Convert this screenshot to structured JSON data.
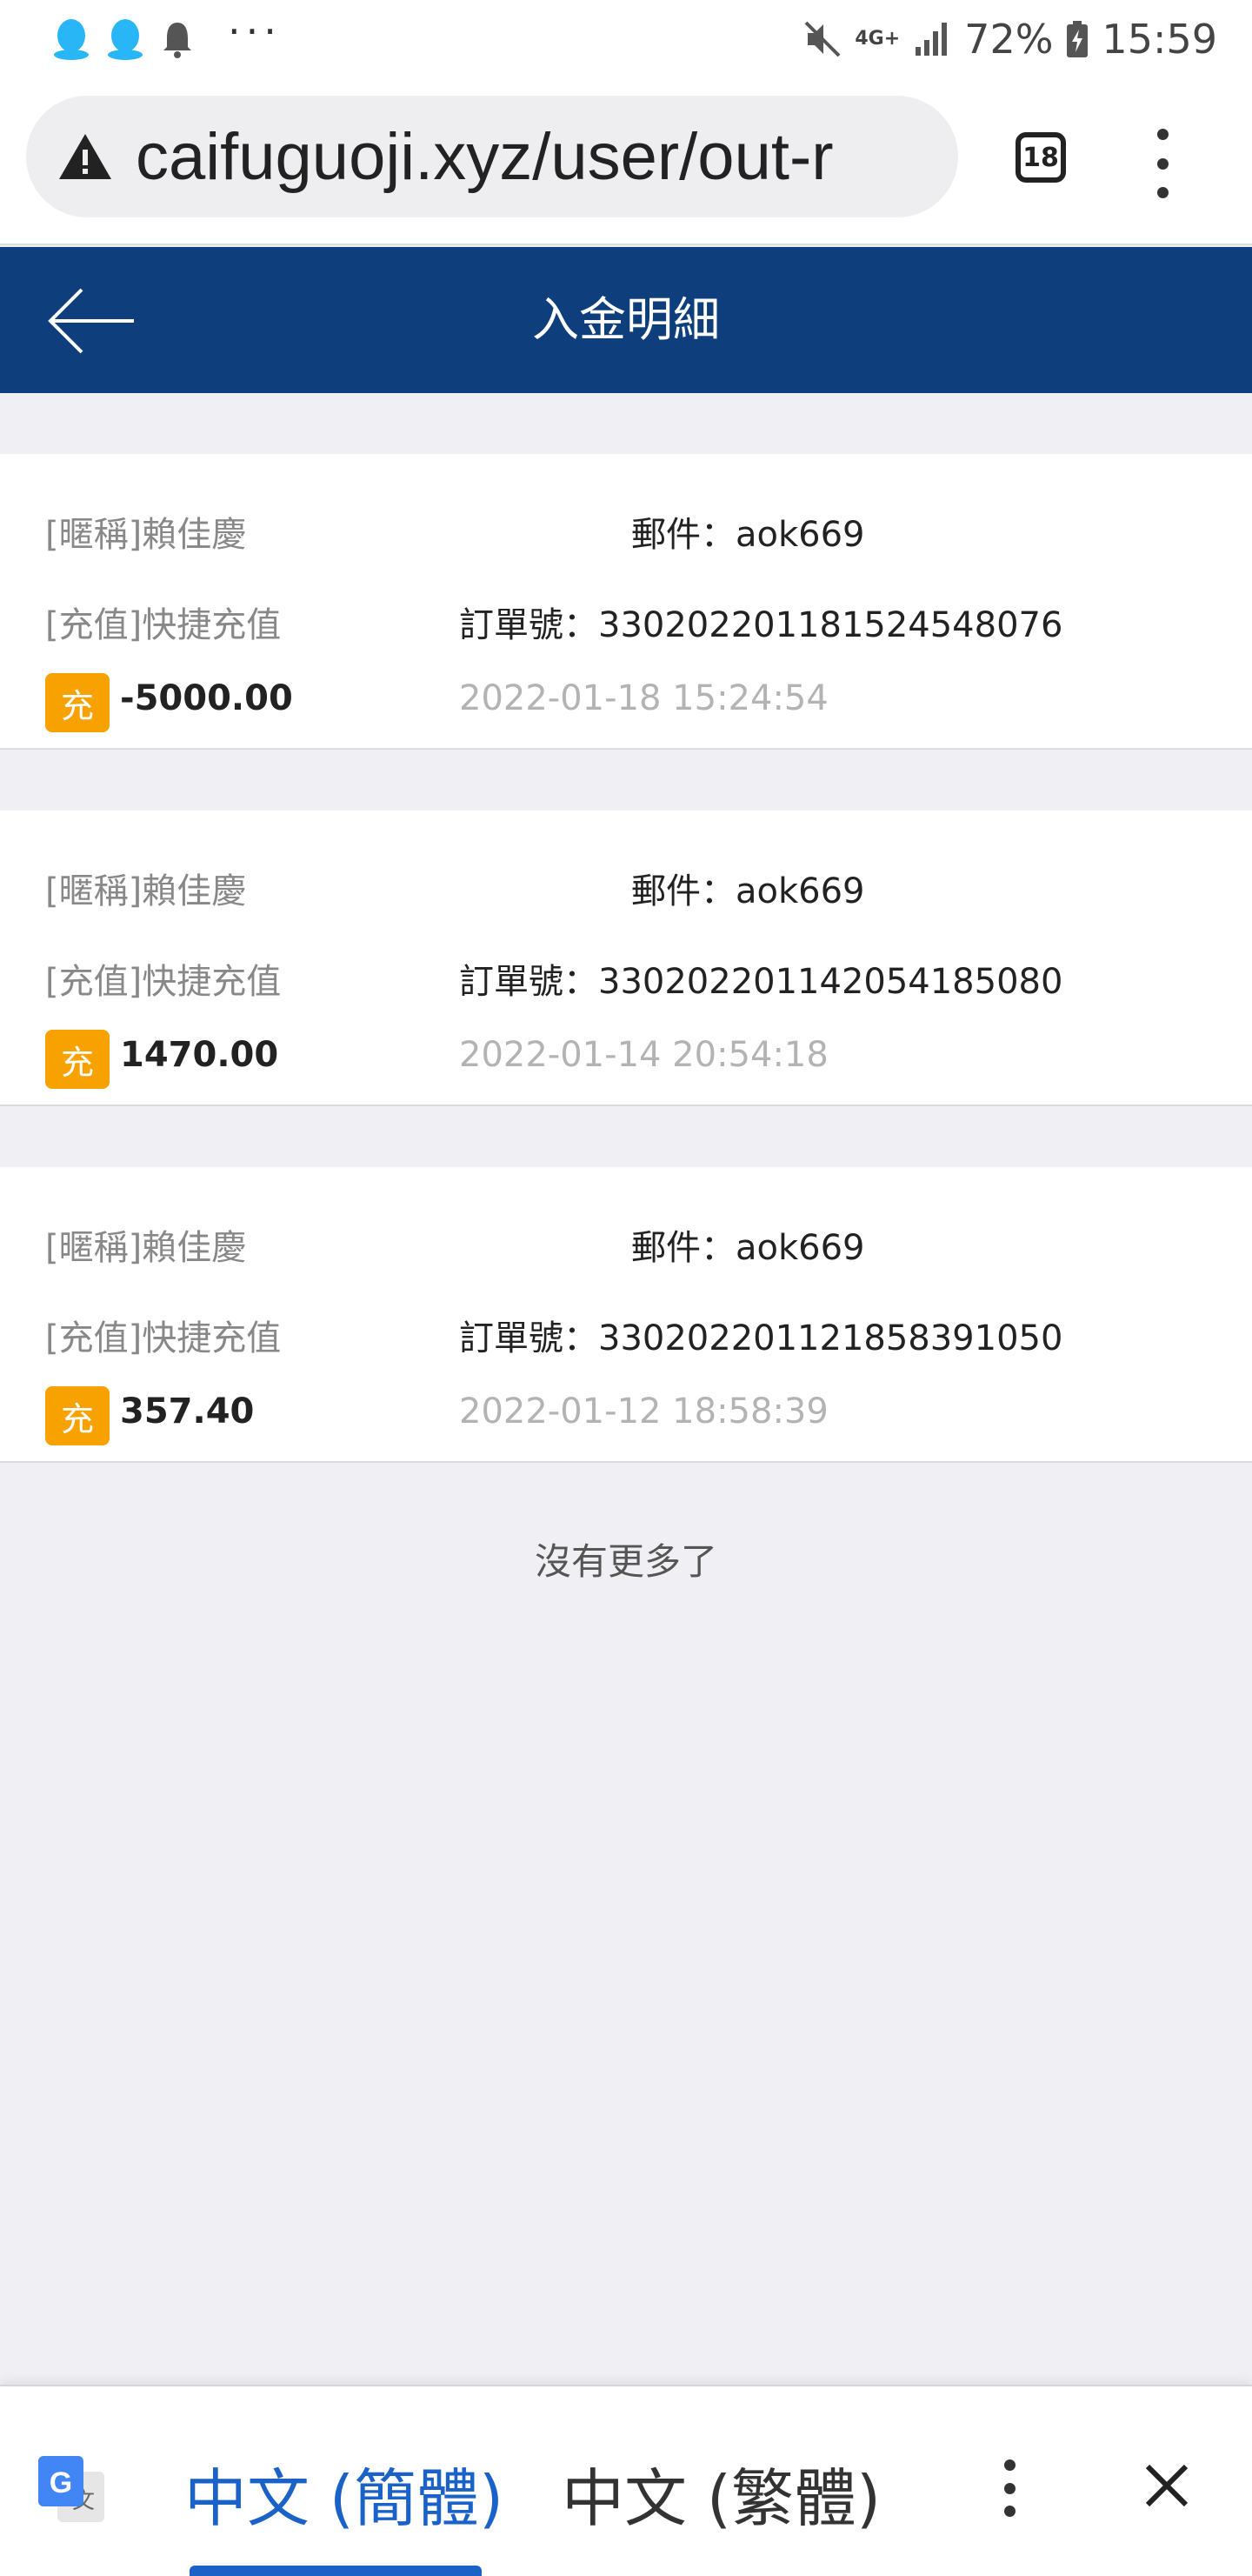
{
  "status_bar": {
    "battery": "72%",
    "time": "15:59",
    "network": "4G+"
  },
  "browser": {
    "url": "caifuguoji.xyz/user/out-r",
    "tab_count": "18"
  },
  "header": {
    "title": "入金明細"
  },
  "records": [
    {
      "nickname": "[暱稱]賴佳慶",
      "email": "郵件：aok669",
      "type": "[充值]快捷充值",
      "order": "訂單號：33020220118152454807​6",
      "badge": "充",
      "amount": "-5000.00",
      "datetime": "2022-01-18 15:24:54"
    },
    {
      "nickname": "[暱稱]賴佳慶",
      "email": "郵件：aok669",
      "type": "[充值]快捷充值",
      "order": "訂單號：330202201142054185080",
      "badge": "充",
      "amount": "1470.00",
      "datetime": "2022-01-14 20:54:18"
    },
    {
      "nickname": "[暱稱]賴佳慶",
      "email": "郵件：aok669",
      "type": "[充值]快捷充值",
      "order": "訂單號：330202201121858391050",
      "badge": "充",
      "amount": "357.40",
      "datetime": "2022-01-12 18:58:39"
    }
  ],
  "footer_text": "沒有更多了",
  "translate_bar": {
    "lang_selected": "中文 (簡體)",
    "lang_other": "中文 (繁體)"
  },
  "colors": {
    "header_bg": "#0e3f7c",
    "badge_bg": "#f7a200",
    "translate_accent": "#1a62c8"
  }
}
